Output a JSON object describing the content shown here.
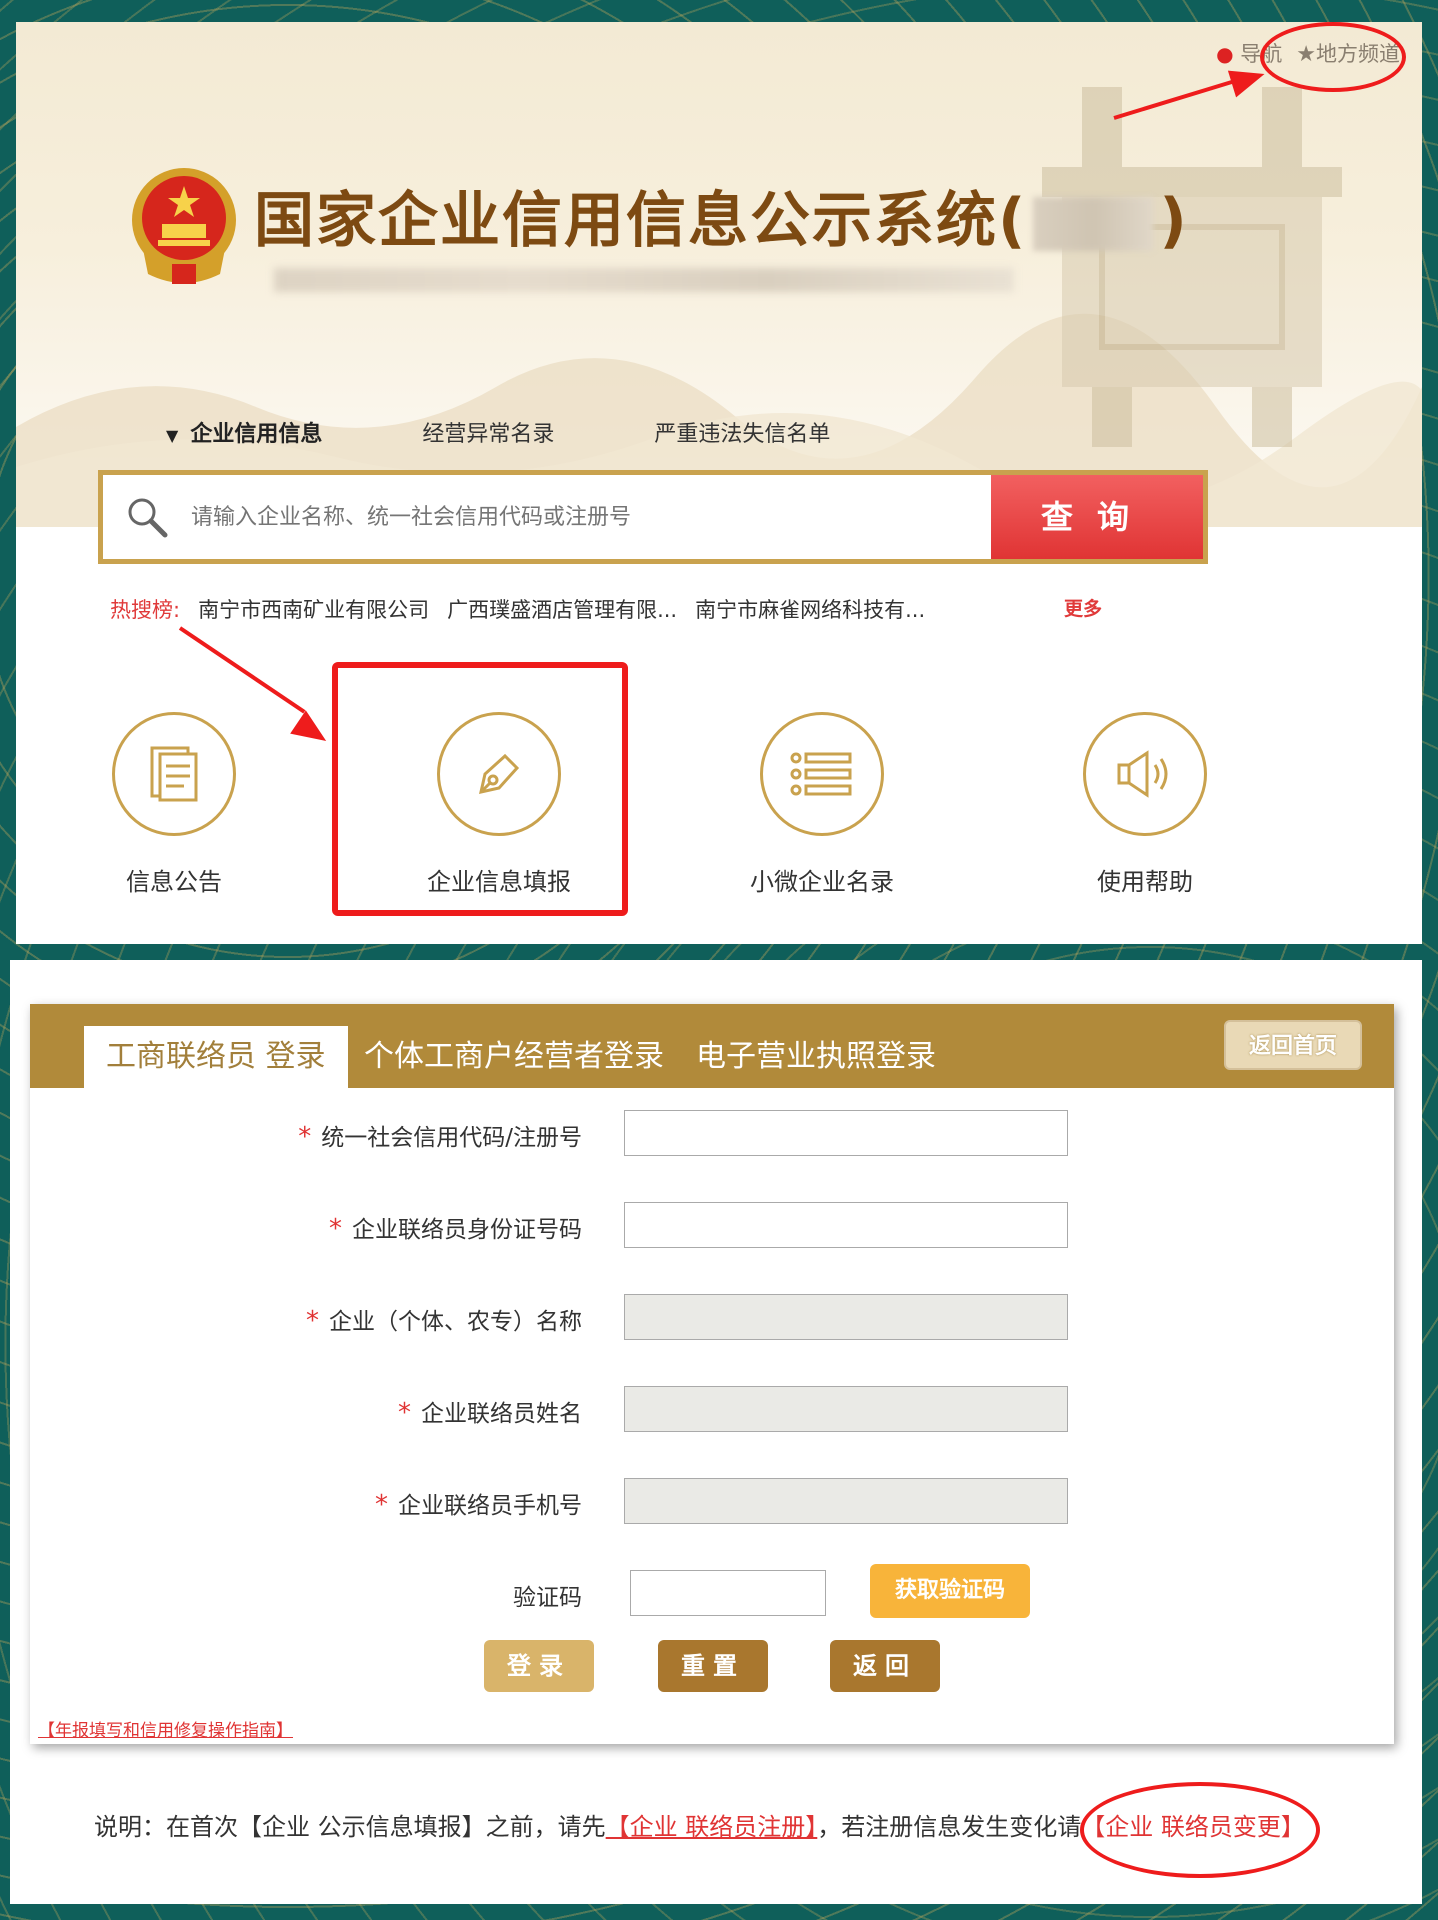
{
  "topbar": {
    "nav_label": "导航",
    "local_label": "地方频道"
  },
  "header": {
    "title": "国家企业信用信息公示系统(",
    "title_end": ")"
  },
  "search": {
    "tabs": [
      "企业信用信息",
      "经营异常名录",
      "严重违法失信名单"
    ],
    "placeholder": "请输入企业名称、统一社会信用代码或注册号",
    "button": "查询"
  },
  "hot": {
    "label": "热搜榜:",
    "items": [
      "南宁市西南矿业有限公司",
      "广西璞盛酒店管理有限...",
      "南宁市麻雀网络科技有..."
    ],
    "more": "更多"
  },
  "functions": [
    "信息公告",
    "企业信息填报",
    "小微企业名录",
    "使用帮助"
  ],
  "login": {
    "tabs": [
      "工商联络员 登录",
      "个体工商户经营者登录",
      "电子营业执照登录"
    ],
    "back_home": "返回首页",
    "fields": [
      {
        "label": "统一社会信用代码/注册号",
        "required": true,
        "disabled": false
      },
      {
        "label": "企业联络员身份证号码",
        "required": true,
        "disabled": false
      },
      {
        "label": "企业（个体、农专）名称",
        "required": true,
        "disabled": true
      },
      {
        "label": "企业联络员姓名",
        "required": true,
        "disabled": true
      },
      {
        "label": "企业联络员手机号",
        "required": true,
        "disabled": true
      }
    ],
    "captcha_label": "验证码",
    "captcha_button": "获取验证码",
    "buttons": [
      "登录",
      "重置",
      "返回"
    ],
    "guide_link": "【年报填写和信用修复操作指南】"
  },
  "note": {
    "prefix": "说明：在首次【企业 公示信息填报】之前，请先",
    "register_link": "【企业 联络员注册】",
    "middle": "，若注册信息发生变化请",
    "change_link": "【企业 联络员变更】"
  },
  "colors": {
    "gold": "#b18a3a",
    "red": "#e03434",
    "title_brown": "#7d4a12",
    "frame": "#0f5f5a"
  },
  "icons": [
    "location-pin-icon",
    "star-icon",
    "national-emblem-icon",
    "search-icon",
    "document-icon",
    "pen-icon",
    "list-icon",
    "speaker-icon"
  ]
}
